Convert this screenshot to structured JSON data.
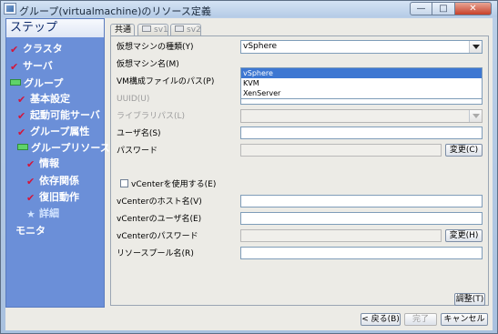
{
  "window": {
    "title": "グループ(virtualmachine)のリソース定義",
    "minimize": "—",
    "maximize": "□",
    "close": "✕"
  },
  "steps": {
    "header": "ステップ",
    "items": [
      {
        "label": "クラスタ",
        "icon": "check-icon"
      },
      {
        "label": "サーバ",
        "icon": "check-icon"
      },
      {
        "label": "グループ",
        "icon": "flag-icon"
      },
      {
        "label": "基本設定",
        "icon": "check-icon"
      },
      {
        "label": "起動可能サーバ",
        "icon": "check-icon"
      },
      {
        "label": "グループ属性",
        "icon": "check-icon"
      },
      {
        "label": "グループリソース",
        "icon": "flag-icon"
      },
      {
        "label": "情報",
        "icon": "check-icon"
      },
      {
        "label": "依存関係",
        "icon": "check-icon"
      },
      {
        "label": "復旧動作",
        "icon": "check-icon"
      },
      {
        "label": "詳細",
        "icon": "star-icon"
      },
      {
        "label": "モニタ",
        "icon": ""
      }
    ]
  },
  "tabs": [
    "共通",
    "sv1",
    "sv2"
  ],
  "form": {
    "vm_type_label": "仮想マシンの種類(Y)",
    "vm_type_value": "vSphere",
    "vm_type_options": [
      "vSphere",
      "KVM",
      "XenServer"
    ],
    "vm_name_label": "仮想マシン名(M)",
    "vm_path_label": "VM構成ファイルのパス(P)",
    "uuid_label": "UUID(U)",
    "library_path_label": "ライブラリパス(L)",
    "user_label": "ユーザ名(S)",
    "password_label": "パスワード",
    "change_button": "変更(C)",
    "vcenter_checkbox": "vCenterを使用する(E)",
    "vcenter_host_label": "vCenterのホスト名(V)",
    "vcenter_user_label": "vCenterのユーザ名(E)",
    "vcenter_password_label": "vCenterのパスワード",
    "change_button_h": "変更(H)",
    "resource_pool_label": "リソースプール名(R)",
    "adjust_button": "調整(T)"
  },
  "footer": {
    "back": "< 戻る(B)",
    "finish": "完了",
    "cancel": "キャンセル"
  },
  "colors": {
    "step_panel": "#6b8fd8",
    "check": "#d4143a",
    "selected_option": "#3d77d2"
  }
}
